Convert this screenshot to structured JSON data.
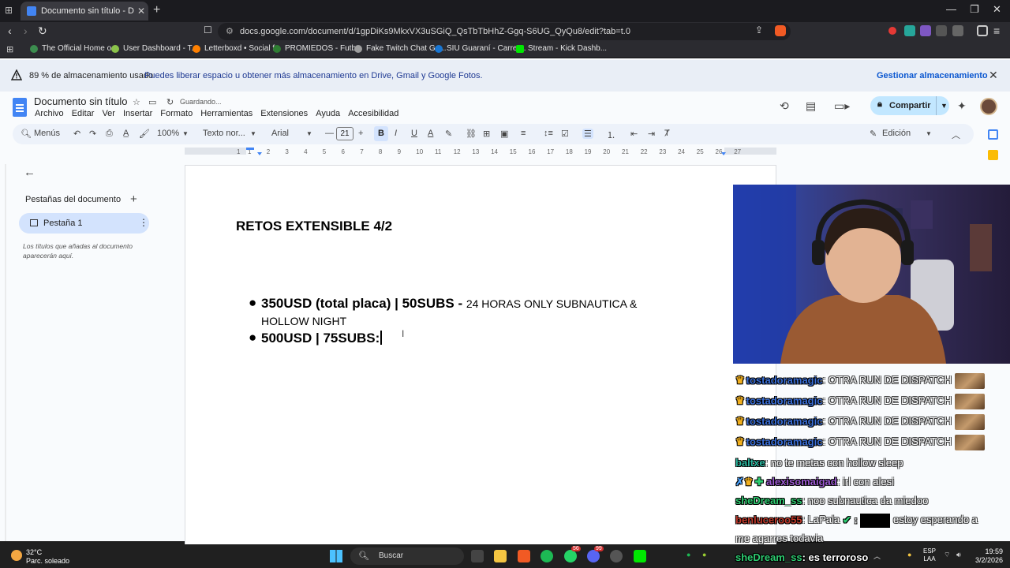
{
  "browser": {
    "tab_title": "Documento sin título - Documen",
    "url": "docs.google.com/document/d/1gpDiKs9MkxVX3uSGiQ_QsTbTbHhZ-Ggq-S6UG_QyQu8/edit?tab=t.0",
    "bookmarks": [
      "The Official Home o...",
      "User Dashboard - T...",
      "Letterboxd • Social f...",
      "PROMIEDOS - Futb...",
      "Fake Twitch Chat Ge...",
      "SIU Guaraní - Carrer...",
      "Stream - Kick Dashb..."
    ]
  },
  "banner": {
    "usage": "89 % de almacenamiento usado",
    "message": "Puedes liberar espacio u obtener más almacenamiento en Drive, Gmail y Google Fotos.",
    "link": "Gestionar almacenamiento"
  },
  "doc": {
    "title": "Documento sin título",
    "status": "Guardando...",
    "menus": [
      "Archivo",
      "Editar",
      "Ver",
      "Insertar",
      "Formato",
      "Herramientas",
      "Extensiones",
      "Ayuda",
      "Accesibilidad"
    ],
    "share_label": "Compartir",
    "mode_label": "Edición"
  },
  "format_bar": {
    "menus_label": "Menús",
    "zoom": "100%",
    "style": "Texto nor...",
    "font": "Arial",
    "font_size": "21"
  },
  "ruler_ticks": [
    "1",
    "1",
    "2",
    "3",
    "4",
    "5",
    "6",
    "7",
    "8",
    "9",
    "10",
    "11",
    "12",
    "13",
    "14",
    "15",
    "16",
    "17",
    "18",
    "19",
    "20",
    "21",
    "22",
    "23",
    "24",
    "25",
    "26",
    "27"
  ],
  "sidebar": {
    "header": "Pestañas del documento",
    "tab_label": "Pestaña 1",
    "hint": "Los títulos que añadas al documento aparecerán aquí."
  },
  "content": {
    "heading": "RETOS EXTENSIBLE 4/2",
    "item1_bold": "350USD (total placa) | 50SUBS - ",
    "item1_normal": "24 HORAS ONLY SUBNAUTICA & HOLLOW NIGHT",
    "item2_bold": "500USD | 75SUBS:"
  },
  "chat": [
    {
      "user": "tostadoramagic",
      "msg": "OTRA RUN DE DISPATCH",
      "color": "#3a6fd8"
    },
    {
      "user": "tostadoramagic",
      "msg": "OTRA RUN DE DISPATCH",
      "color": "#3a6fd8"
    },
    {
      "user": "tostadoramagic",
      "msg": "OTRA RUN DE DISPATCH",
      "color": "#3a6fd8"
    },
    {
      "user": "tostadoramagic",
      "msg": "OTRA RUN DE DISPATCH",
      "color": "#3a6fd8"
    },
    {
      "user": "baltxe",
      "msg": "no te metas con hollow sleep",
      "color": "#2bb8a0"
    },
    {
      "user": "alexisomaigad",
      "msg": "irl con alesi",
      "color": "#9b59d0"
    },
    {
      "user": "sheDream_ss",
      "msg": "noo subnautica da miedoo",
      "color": "#2ecc71"
    },
    {
      "user": "benluceroo55",
      "msg": "LaPala",
      "msg2": "estoy esperando a",
      "color": "#c0392b"
    },
    {
      "user": "",
      "msg": "me agarres todavia",
      "color": "#fff"
    },
    {
      "user": "sheDream_ss",
      "msg": "es terroroso",
      "color": "#2ecc71"
    }
  ],
  "taskbar": {
    "temp": "32°C",
    "weather": "Parc. soleado",
    "search": "Buscar",
    "lang1": "ESP",
    "lang2": "LAA",
    "time": "19:59",
    "date": "3/2/2026",
    "badge1": "56",
    "badge2": "99"
  }
}
